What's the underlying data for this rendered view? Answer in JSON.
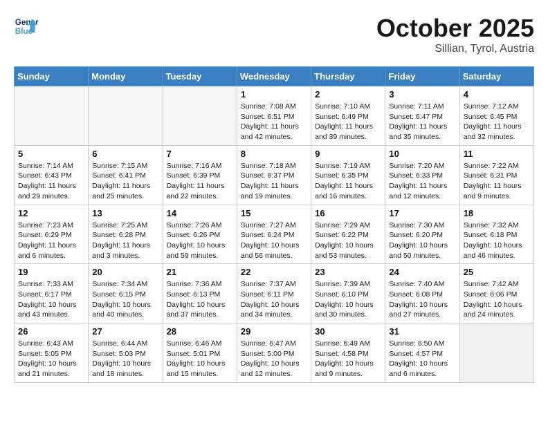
{
  "header": {
    "logo_line1": "General",
    "logo_line2": "Blue",
    "month": "October 2025",
    "location": "Sillian, Tyrol, Austria"
  },
  "weekdays": [
    "Sunday",
    "Monday",
    "Tuesday",
    "Wednesday",
    "Thursday",
    "Friday",
    "Saturday"
  ],
  "weeks": [
    [
      {
        "day": "",
        "info": ""
      },
      {
        "day": "",
        "info": ""
      },
      {
        "day": "",
        "info": ""
      },
      {
        "day": "1",
        "info": "Sunrise: 7:08 AM\nSunset: 6:51 PM\nDaylight: 11 hours\nand 42 minutes."
      },
      {
        "day": "2",
        "info": "Sunrise: 7:10 AM\nSunset: 6:49 PM\nDaylight: 11 hours\nand 39 minutes."
      },
      {
        "day": "3",
        "info": "Sunrise: 7:11 AM\nSunset: 6:47 PM\nDaylight: 11 hours\nand 35 minutes."
      },
      {
        "day": "4",
        "info": "Sunrise: 7:12 AM\nSunset: 6:45 PM\nDaylight: 11 hours\nand 32 minutes."
      }
    ],
    [
      {
        "day": "5",
        "info": "Sunrise: 7:14 AM\nSunset: 6:43 PM\nDaylight: 11 hours\nand 29 minutes."
      },
      {
        "day": "6",
        "info": "Sunrise: 7:15 AM\nSunset: 6:41 PM\nDaylight: 11 hours\nand 25 minutes."
      },
      {
        "day": "7",
        "info": "Sunrise: 7:16 AM\nSunset: 6:39 PM\nDaylight: 11 hours\nand 22 minutes."
      },
      {
        "day": "8",
        "info": "Sunrise: 7:18 AM\nSunset: 6:37 PM\nDaylight: 11 hours\nand 19 minutes."
      },
      {
        "day": "9",
        "info": "Sunrise: 7:19 AM\nSunset: 6:35 PM\nDaylight: 11 hours\nand 16 minutes."
      },
      {
        "day": "10",
        "info": "Sunrise: 7:20 AM\nSunset: 6:33 PM\nDaylight: 11 hours\nand 12 minutes."
      },
      {
        "day": "11",
        "info": "Sunrise: 7:22 AM\nSunset: 6:31 PM\nDaylight: 11 hours\nand 9 minutes."
      }
    ],
    [
      {
        "day": "12",
        "info": "Sunrise: 7:23 AM\nSunset: 6:29 PM\nDaylight: 11 hours\nand 6 minutes."
      },
      {
        "day": "13",
        "info": "Sunrise: 7:25 AM\nSunset: 6:28 PM\nDaylight: 11 hours\nand 3 minutes."
      },
      {
        "day": "14",
        "info": "Sunrise: 7:26 AM\nSunset: 6:26 PM\nDaylight: 10 hours\nand 59 minutes."
      },
      {
        "day": "15",
        "info": "Sunrise: 7:27 AM\nSunset: 6:24 PM\nDaylight: 10 hours\nand 56 minutes."
      },
      {
        "day": "16",
        "info": "Sunrise: 7:29 AM\nSunset: 6:22 PM\nDaylight: 10 hours\nand 53 minutes."
      },
      {
        "day": "17",
        "info": "Sunrise: 7:30 AM\nSunset: 6:20 PM\nDaylight: 10 hours\nand 50 minutes."
      },
      {
        "day": "18",
        "info": "Sunrise: 7:32 AM\nSunset: 6:18 PM\nDaylight: 10 hours\nand 46 minutes."
      }
    ],
    [
      {
        "day": "19",
        "info": "Sunrise: 7:33 AM\nSunset: 6:17 PM\nDaylight: 10 hours\nand 43 minutes."
      },
      {
        "day": "20",
        "info": "Sunrise: 7:34 AM\nSunset: 6:15 PM\nDaylight: 10 hours\nand 40 minutes."
      },
      {
        "day": "21",
        "info": "Sunrise: 7:36 AM\nSunset: 6:13 PM\nDaylight: 10 hours\nand 37 minutes."
      },
      {
        "day": "22",
        "info": "Sunrise: 7:37 AM\nSunset: 6:11 PM\nDaylight: 10 hours\nand 34 minutes."
      },
      {
        "day": "23",
        "info": "Sunrise: 7:39 AM\nSunset: 6:10 PM\nDaylight: 10 hours\nand 30 minutes."
      },
      {
        "day": "24",
        "info": "Sunrise: 7:40 AM\nSunset: 6:08 PM\nDaylight: 10 hours\nand 27 minutes."
      },
      {
        "day": "25",
        "info": "Sunrise: 7:42 AM\nSunset: 6:06 PM\nDaylight: 10 hours\nand 24 minutes."
      }
    ],
    [
      {
        "day": "26",
        "info": "Sunrise: 6:43 AM\nSunset: 5:05 PM\nDaylight: 10 hours\nand 21 minutes."
      },
      {
        "day": "27",
        "info": "Sunrise: 6:44 AM\nSunset: 5:03 PM\nDaylight: 10 hours\nand 18 minutes."
      },
      {
        "day": "28",
        "info": "Sunrise: 6:46 AM\nSunset: 5:01 PM\nDaylight: 10 hours\nand 15 minutes."
      },
      {
        "day": "29",
        "info": "Sunrise: 6:47 AM\nSunset: 5:00 PM\nDaylight: 10 hours\nand 12 minutes."
      },
      {
        "day": "30",
        "info": "Sunrise: 6:49 AM\nSunset: 4:58 PM\nDaylight: 10 hours\nand 9 minutes."
      },
      {
        "day": "31",
        "info": "Sunrise: 6:50 AM\nSunset: 4:57 PM\nDaylight: 10 hours\nand 6 minutes."
      },
      {
        "day": "",
        "info": ""
      }
    ]
  ]
}
